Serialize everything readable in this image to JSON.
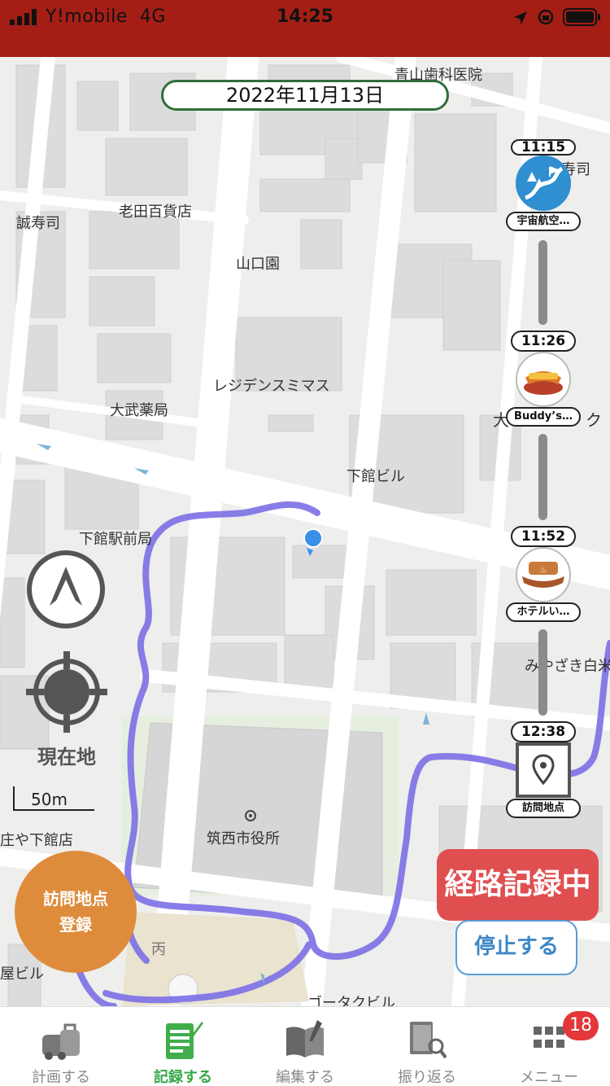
{
  "status_bar": {
    "carrier": "Y!mobile",
    "network": "4G",
    "time": "14:25"
  },
  "date": "2022年11月13日",
  "map_labels": {
    "aoyama": "青山歯科医院",
    "oita": "老田百貨店",
    "makoto": "誠寿司",
    "yamaguchi": "山口園",
    "residence": "レジデンスミマス",
    "obu": "大武薬局",
    "shimodate_bldg": "下館ビル",
    "ekimae": "下館駅前局",
    "sushi": "寿司",
    "dai": "大",
    "ku": "ク",
    "miyazaki": "みやざき白米",
    "city_hall": "筑西市役所",
    "shoya": "庄や下館店",
    "hei": "丙",
    "ya_bldg": "屋ビル",
    "gota": "ゴータクビル"
  },
  "timeline": [
    {
      "time": "11:15",
      "name": "宇宙航空…",
      "icon": "park-trail-icon"
    },
    {
      "time": "11:26",
      "name": "Buddy’s…",
      "icon": "gourmet-icon"
    },
    {
      "time": "11:52",
      "name": "ホテルい…",
      "icon": "hot-spring-icon"
    },
    {
      "time": "12:38",
      "name": "訪問地点",
      "icon": "map-pin-icon"
    }
  ],
  "controls": {
    "current_location": "現在地",
    "scale": "50m",
    "register_line1": "訪問地点",
    "register_line2": "登録",
    "recording": "経路記録中",
    "stop": "停止する"
  },
  "tabs": [
    {
      "label": "計画する",
      "icon": "car-luggage-icon"
    },
    {
      "label": "記録する",
      "icon": "notepad-pen-icon"
    },
    {
      "label": "編集する",
      "icon": "open-book-icon"
    },
    {
      "label": "振り返る",
      "icon": "album-search-icon"
    },
    {
      "label": "メニュー",
      "icon": "grid-menu-icon"
    }
  ],
  "menu_badge": "18",
  "colors": {
    "status_bar": "#a51e16",
    "route": "#7b6fe6",
    "active_tab": "#38a84a",
    "record_badge": "#e04f50",
    "register_button": "#de8c3c"
  }
}
